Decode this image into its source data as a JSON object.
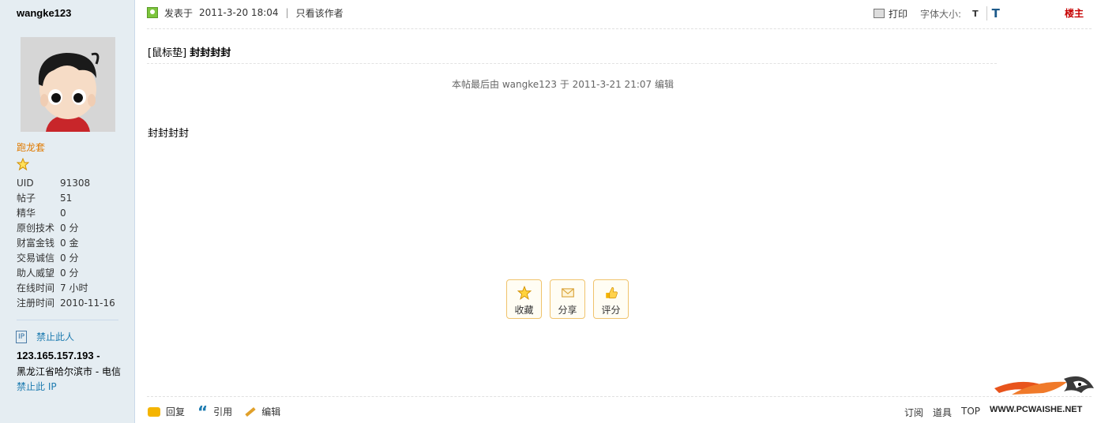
{
  "user": {
    "name": "wangke123",
    "rank": "跑龙套",
    "stats": [
      {
        "label": "UID",
        "value": "91308"
      },
      {
        "label": "帖子",
        "value": "51"
      },
      {
        "label": "精华",
        "value": "0"
      },
      {
        "label": "原创技术",
        "value": "0 分"
      },
      {
        "label": "财富金钱",
        "value": "0 金"
      },
      {
        "label": "交易诚信",
        "value": "0 分"
      },
      {
        "label": "助人威望",
        "value": "0 分"
      },
      {
        "label": "在线时间",
        "value": "7 小时"
      },
      {
        "label": "注册时间",
        "value": "2010-11-16"
      }
    ],
    "ip_badge": "IP",
    "ban_user": "禁止此人",
    "ip": "123.165.157.193 -",
    "location": "黑龙江省哈尔滨市 - 电信",
    "ban_ip": "禁止此 IP"
  },
  "post": {
    "posted_label": "发表于",
    "posted_time": "2011-3-20 18:04",
    "only_author": "只看该作者",
    "print": "打印",
    "font_size_label": "字体大小:",
    "font_small": "T",
    "font_large": "T",
    "floor": "楼主",
    "title_prefix": "[鼠标垫]",
    "title": "封封封封",
    "edited": "本帖最后由 wangke123 于 2011-3-21 21:07 编辑",
    "body": "封封封封"
  },
  "actions": [
    {
      "label": "收藏",
      "icon": "star-icon"
    },
    {
      "label": "分享",
      "icon": "envelope-icon"
    },
    {
      "label": "评分",
      "icon": "thumb-icon"
    }
  ],
  "footer": {
    "reply": "回复",
    "quote": "引用",
    "edit": "编辑",
    "subscribe": "订阅",
    "tools": "道具",
    "top": "TOP",
    "watermark": "WWW.PCWAISHE.NET"
  },
  "colors": {
    "sidebar_bg": "#e5edf2",
    "link": "#1d7bb0",
    "rank": "#e07a00",
    "floor": "#c60000",
    "action_border": "#f0c36c"
  }
}
